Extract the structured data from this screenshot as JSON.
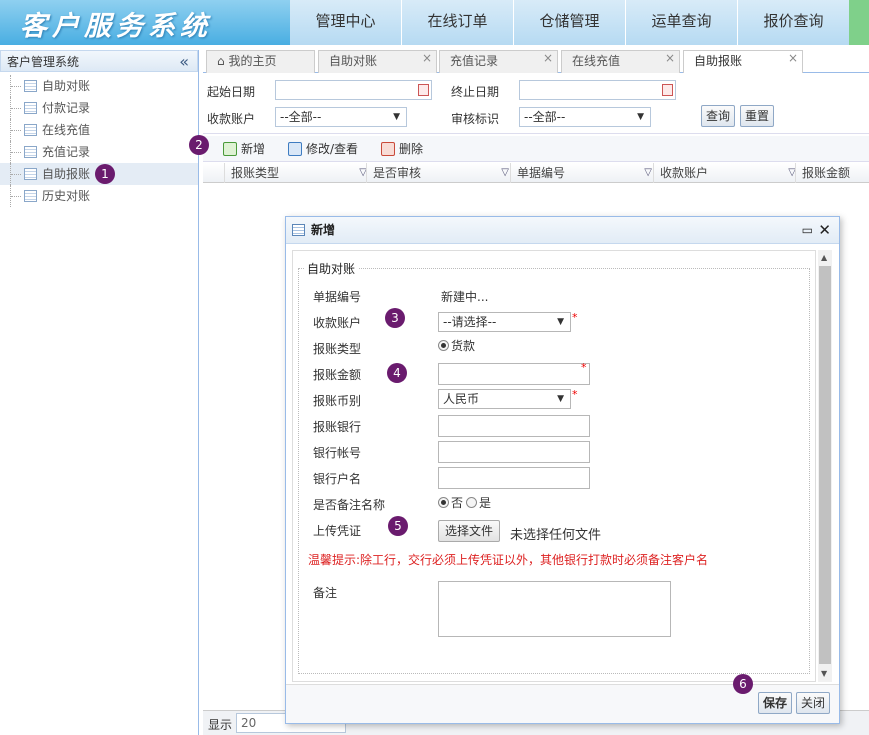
{
  "header": {
    "title": "客户服务系统",
    "nav": [
      "管理中心",
      "在线订单",
      "仓储管理",
      "运单查询",
      "报价查询"
    ]
  },
  "sidebar": {
    "title": "客户管理系统",
    "items": [
      {
        "label": "自助对账"
      },
      {
        "label": "付款记录"
      },
      {
        "label": "在线充值"
      },
      {
        "label": "充值记录"
      },
      {
        "label": "自助报账"
      },
      {
        "label": "历史对账"
      }
    ]
  },
  "tabs": [
    {
      "label": "我的主页"
    },
    {
      "label": "自助对账"
    },
    {
      "label": "充值记录"
    },
    {
      "label": "在线充值"
    },
    {
      "label": "自助报账"
    }
  ],
  "search": {
    "start_date": "起始日期",
    "end_date": "终止日期",
    "account": "收款账户",
    "account_value": "--全部--",
    "audit": "审核标识",
    "audit_value": "--全部--",
    "query": "查询",
    "reset": "重置"
  },
  "toolbar": {
    "add": "新增",
    "edit": "修改/查看",
    "delete": "删除"
  },
  "columns": [
    "报账类型",
    "是否审核",
    "单据编号",
    "收款账户",
    "报账金额"
  ],
  "footer": {
    "show": "显示",
    "page_size": "20"
  },
  "badges": [
    "1",
    "2",
    "3",
    "4",
    "5",
    "6"
  ],
  "dialog": {
    "title": "新增",
    "legend": "自助对账",
    "doc_no_label": "单据编号",
    "doc_no_value": "新建中...",
    "account_label": "收款账户",
    "account_value": "--请选择--",
    "type_label": "报账类型",
    "type_value": "货款",
    "amount_label": "报账金额",
    "currency_label": "报账币别",
    "currency_value": "人民币",
    "bank_label": "报账银行",
    "bank_no_label": "银行帐号",
    "bank_name_label": "银行户名",
    "remark_name_label": "是否备注名称",
    "no": "否",
    "yes": "是",
    "upload_label": "上传凭证",
    "choose_file": "选择文件",
    "no_file": "未选择任何文件",
    "warning": "温馨提示:除工行，交行必须上传凭证以外，其他银行打款时必须备注客户名",
    "note_label": "备注",
    "save": "保存",
    "close": "关闭"
  },
  "colors": {
    "accent": "#49aee2",
    "badge": "#6a1b6e",
    "warning": "#d22222"
  }
}
